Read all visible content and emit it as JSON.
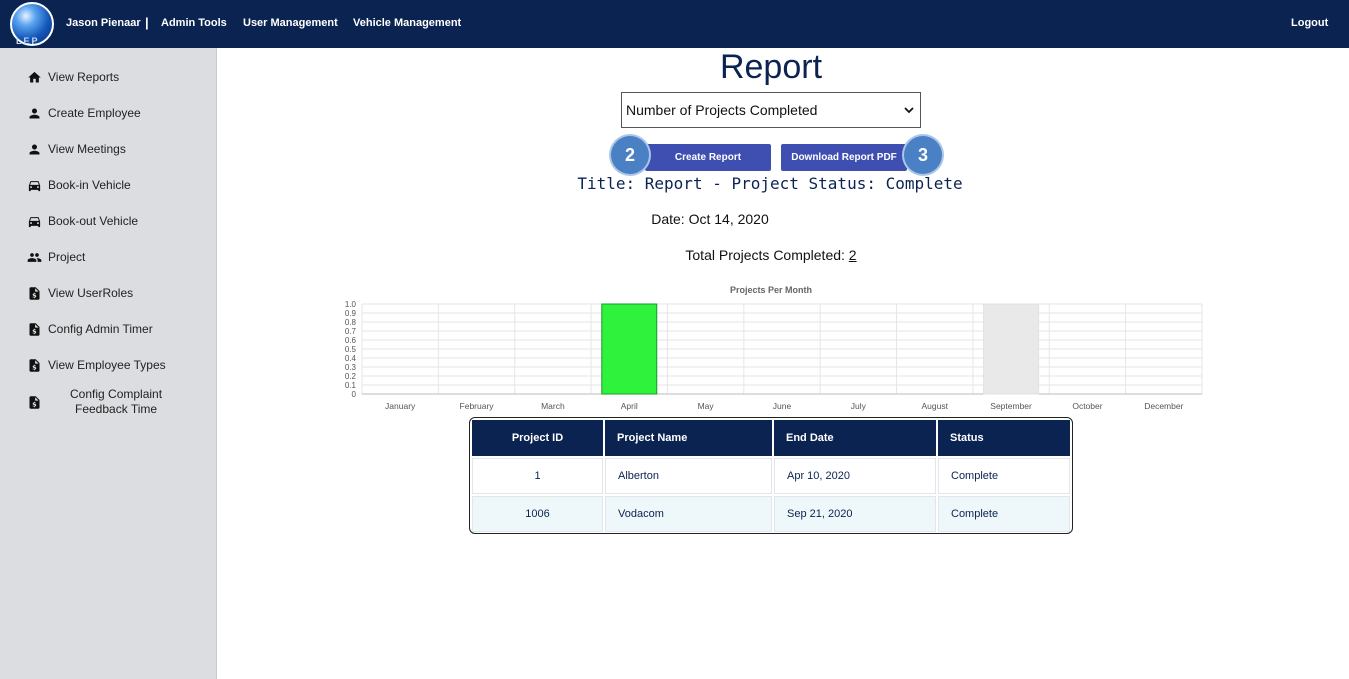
{
  "topnav": {
    "logo_text": "LEP",
    "user_name": "Jason Pienaar",
    "separator": "|",
    "items": [
      "Admin Tools",
      "User Management",
      "Vehicle Management"
    ],
    "logout": "Logout"
  },
  "sidebar": {
    "items": [
      {
        "label": "View Reports",
        "icon": "home-icon"
      },
      {
        "label": "Create Employee",
        "icon": "person-icon"
      },
      {
        "label": "View Meetings",
        "icon": "person-icon"
      },
      {
        "label": "Book-in Vehicle",
        "icon": "car-icon"
      },
      {
        "label": "Book-out Vehicle",
        "icon": "car-icon"
      },
      {
        "label": "Project",
        "icon": "people-icon"
      },
      {
        "label": "View UserRoles",
        "icon": "document-icon"
      },
      {
        "label": "Config Admin Timer",
        "icon": "document-icon"
      },
      {
        "label": "View Employee Types",
        "icon": "document-icon"
      },
      {
        "label": "Config Complaint\nFeedback Time",
        "icon": "document-icon",
        "line1": "Config Complaint",
        "line2": "Feedback Time"
      }
    ]
  },
  "main": {
    "title": "Report",
    "report_select": "Number of Projects Completed",
    "create_button": "Create Report",
    "download_button": "Download Report PDF",
    "badge_create": "2",
    "badge_download": "3",
    "report_title": "Title: Report - Project Status: Complete",
    "date_label": "Date: Oct 14, 2020",
    "total_label": "Total Projects Completed: ",
    "total_value": "2"
  },
  "chart_data": {
    "type": "bar",
    "title": "Projects Per Month",
    "categories": [
      "January",
      "February",
      "March",
      "April",
      "May",
      "June",
      "July",
      "August",
      "September",
      "October",
      "December"
    ],
    "values": [
      0,
      0,
      0,
      1,
      0,
      0,
      0,
      0,
      1,
      0,
      0
    ],
    "bar_colors": [
      "#2ef23c",
      "#2ef23c",
      "#2ef23c",
      "#2ef23c",
      "#2ef23c",
      "#2ef23c",
      "#2ef23c",
      "#2ef23c",
      "#e9e9e9",
      "#2ef23c",
      "#2ef23c"
    ],
    "ylim": [
      0,
      1
    ],
    "y_ticks": [
      "0",
      "0.1",
      "0.2",
      "0.3",
      "0.4",
      "0.5",
      "0.6",
      "0.7",
      "0.8",
      "0.9",
      "1.0"
    ],
    "grid": true,
    "xlabel": "",
    "ylabel": ""
  },
  "table": {
    "headers": [
      "Project ID",
      "Project Name",
      "End Date",
      "Status"
    ],
    "rows": [
      [
        "1",
        "Alberton",
        "Apr 10, 2020",
        "Complete"
      ],
      [
        "1006",
        "Vodacom",
        "Sep 21, 2020",
        "Complete"
      ]
    ]
  }
}
